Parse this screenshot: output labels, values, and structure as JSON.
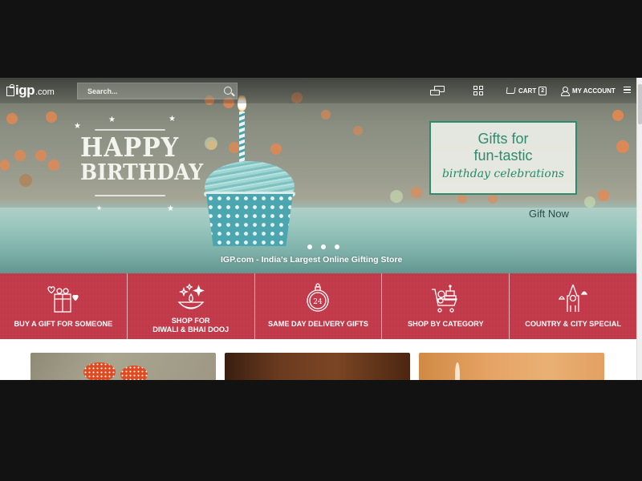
{
  "header": {
    "logo_brand": "igp",
    "logo_suffix": ".com",
    "search_placeholder": "Search...",
    "cart_label": "CART",
    "cart_count": "2",
    "account_label": "MY ACCOUNT",
    "icons": [
      "gift-logo-icon",
      "search-icon",
      "chat-icon",
      "grid-icon",
      "cart-icon",
      "user-icon",
      "hamburger-menu-icon"
    ]
  },
  "hero": {
    "headline_line1": "HAPPY",
    "headline_line2": "BIRTHDAY",
    "promo_line1": "Gifts for",
    "promo_line2": "fun-tastic",
    "promo_line3": "birthday celebrations",
    "cta": "Gift Now",
    "tagline": "IGP.com - India's Largest Online Gifting Store",
    "slide_count": 3,
    "colors": {
      "promo_green": "#2f8a6f"
    }
  },
  "categories": [
    {
      "label": "BUY A GIFT FOR SOMEONE",
      "icon": "gift-box-hearts-icon"
    },
    {
      "label_line1": "SHOP FOR",
      "label_line2": "DIWALI & BHAI DOOJ",
      "icon": "diya-lamp-icon"
    },
    {
      "label": "SAME DAY DELIVERY GIFTS",
      "icon": "stopwatch-24-icon",
      "icon_text": "24"
    },
    {
      "label": "SHOP BY CATEGORY",
      "icon": "shopping-cart-gifts-icon"
    },
    {
      "label": "COUNTRY & CITY SPECIAL",
      "icon": "city-tower-icon"
    }
  ],
  "colors": {
    "category_band": "#c43c4b"
  }
}
